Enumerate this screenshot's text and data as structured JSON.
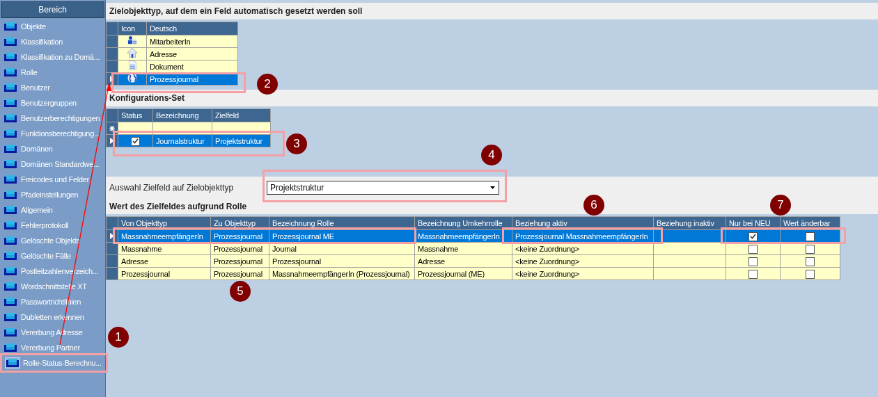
{
  "sidebar": {
    "title": "Bereich",
    "items": [
      {
        "label": "Objekte",
        "selected": false
      },
      {
        "label": "Klassifikation",
        "selected": false
      },
      {
        "label": "Klassifikation zu Domä...",
        "selected": false
      },
      {
        "label": "Rolle",
        "selected": false
      },
      {
        "label": "Benutzer",
        "selected": false
      },
      {
        "label": "Benutzergruppen",
        "selected": false
      },
      {
        "label": "Benutzerberechtigungen",
        "selected": false
      },
      {
        "label": "Funktionsberechtigung...",
        "selected": false
      },
      {
        "label": "Domänen",
        "selected": false
      },
      {
        "label": "Domänen Standardwe...",
        "selected": false
      },
      {
        "label": "Freicodes und Felder",
        "selected": false
      },
      {
        "label": "Pfadeinstellungen",
        "selected": false
      },
      {
        "label": "Allgemein",
        "selected": false
      },
      {
        "label": "Fehlerprotokoll",
        "selected": false
      },
      {
        "label": "Gelöschte Objekte",
        "selected": false
      },
      {
        "label": "Gelöschte Fälle",
        "selected": false
      },
      {
        "label": "Postleitzahlenverzeich...",
        "selected": false
      },
      {
        "label": "Wordschnittstelle XT",
        "selected": false
      },
      {
        "label": "Passwortrichtlinien",
        "selected": false
      },
      {
        "label": "Dubletten erkennen",
        "selected": false
      },
      {
        "label": "Vererbung Adresse",
        "selected": false
      },
      {
        "label": "Vererbung Partner",
        "selected": false
      },
      {
        "label": "Rolle-Status-Berechnu...",
        "selected": true
      }
    ]
  },
  "target_section": {
    "title": "Zielobjekttyp, auf dem ein Feld automatisch gesetzt werden soll",
    "columns": [
      "Icon",
      "Deutsch"
    ],
    "rows": [
      {
        "kind": "person",
        "label": "MitarbeiterIn",
        "selected": false
      },
      {
        "kind": "house",
        "label": "Adresse",
        "selected": false
      },
      {
        "kind": "document",
        "label": "Dokument",
        "selected": false
      },
      {
        "kind": "globe",
        "label": "Prozessjournal",
        "selected": true
      }
    ]
  },
  "config_section": {
    "title": "Konfigurations-Set",
    "columns": [
      "Status",
      "Bezeichnung",
      "Zielfeld"
    ],
    "rows": [
      {
        "kind": "new",
        "selected": false
      },
      {
        "kind": "data",
        "checked": true,
        "name": "Journalstruktur",
        "target": "Projektstruktur",
        "selected": true
      }
    ]
  },
  "field_select": {
    "label": "Auswahl Zielfeld auf Zielobjekttyp",
    "value": "Projektstruktur"
  },
  "value_section": {
    "title": "Wert des Zielfeldes aufgrund Rolle",
    "columns": [
      "Von Objekttyp",
      "Zu Objekttyp",
      "Bezeichnung Rolle",
      "Bezeichnung Umkehrrolle",
      "Beziehung aktiv",
      "Beziehung inaktiv",
      "Nur bei NEU",
      "Wert änderbar"
    ],
    "rows": [
      {
        "cells": [
          "MassnahmeempfängerIn",
          "Prozessjournal",
          "Prozessjournal ME",
          "MassnahmeempfängerIn",
          "Prozessjournal MassnahmeempfängerIn"
        ],
        "only_new": true,
        "changeable": false,
        "selected": true
      },
      {
        "cells": [
          "Massnahme",
          "Prozessjournal",
          "Journal",
          "Massnahme",
          "<keine Zuordnung>"
        ],
        "only_new": false,
        "changeable": false,
        "selected": false
      },
      {
        "cells": [
          "Adresse",
          "Prozessjournal",
          "Prozessjournal",
          "Adresse",
          "<keine Zuordnung>"
        ],
        "only_new": false,
        "changeable": false,
        "selected": false
      },
      {
        "cells": [
          "Prozessjournal",
          "Prozessjournal",
          "MassnahmeempfängerIn (Prozessjournal)",
          "Prozessjournal (ME)",
          "<keine Zuordnung>"
        ],
        "only_new": false,
        "changeable": false,
        "selected": false
      }
    ]
  },
  "annotations": [
    {
      "label": "1"
    },
    {
      "label": "2"
    },
    {
      "label": "3"
    },
    {
      "label": "4"
    },
    {
      "label": "5"
    },
    {
      "label": "6"
    },
    {
      "label": "7"
    }
  ]
}
